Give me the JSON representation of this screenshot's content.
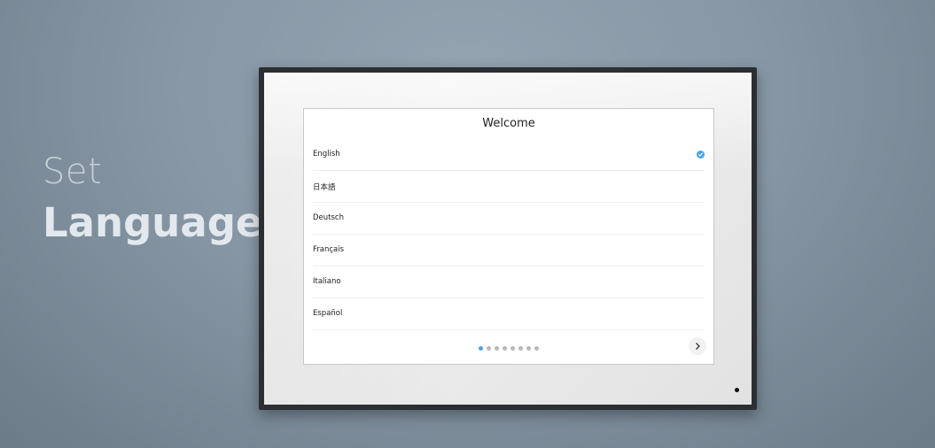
{
  "headline": {
    "line1": "Set",
    "line2": "Language"
  },
  "screen": {
    "title": "Welcome",
    "languages": [
      {
        "label": "English",
        "selected": true
      },
      {
        "label": "日本語",
        "selected": false
      },
      {
        "label": "Deutsch",
        "selected": false
      },
      {
        "label": "Français",
        "selected": false
      },
      {
        "label": "Italiano",
        "selected": false
      },
      {
        "label": "Español",
        "selected": false
      }
    ],
    "page_indicator": {
      "total": 8,
      "current": 1
    },
    "next_icon": "chevron-right-icon",
    "selected_icon": "check-circle-icon"
  },
  "colors": {
    "accent": "#4aa3e6",
    "background": "#8797a5",
    "frame": "#2b2f33"
  }
}
